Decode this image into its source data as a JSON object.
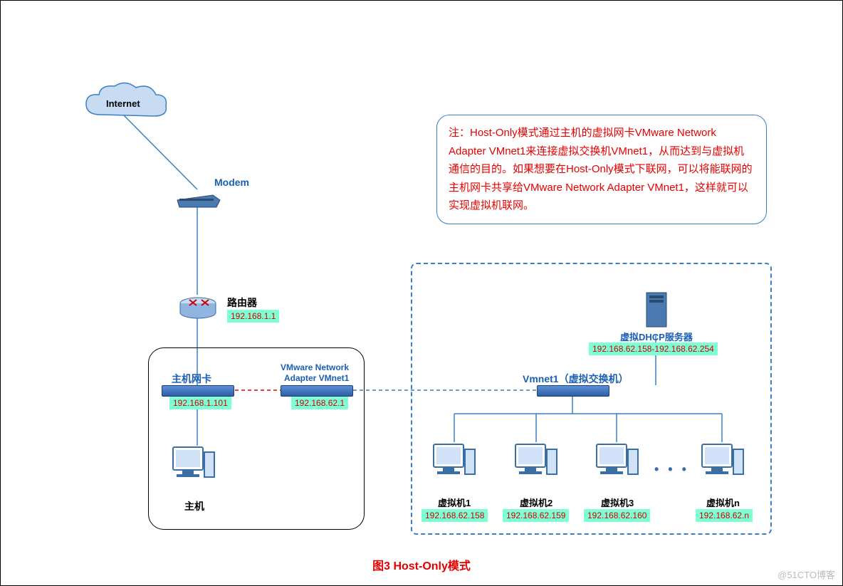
{
  "internet": {
    "label": "Internet"
  },
  "modem": {
    "label": "Modem"
  },
  "router": {
    "label": "路由器",
    "ip": "192.168.1.1"
  },
  "host_box": {
    "nic": {
      "label": "主机网卡",
      "ip": "192.168.1.101"
    },
    "vmnet": {
      "label1": "VMware Network",
      "label2": "Adapter VMnet1",
      "ip": "192.168.62.1"
    },
    "host": {
      "label": "主机"
    }
  },
  "note": {
    "text": "注：Host-Only模式通过主机的虚拟网卡VMware Network Adapter VMnet1来连接虚拟交换机VMnet1，从而达到与虚拟机通信的目的。如果想要在Host-Only模式下联网，可以将能联网的主机网卡共享给VMware Network Adapter VMnet1，这样就可以实现虚拟机联网。"
  },
  "vm_box": {
    "dhcp": {
      "label": "虚拟DHCP服务器",
      "ip": "192.168.62.158-192.168.62.254"
    },
    "switch": {
      "label": "Vmnet1（虚拟交换机）"
    },
    "vms": [
      {
        "label": "虚拟机1",
        "ip": "192.168.62.158"
      },
      {
        "label": "虚拟机2",
        "ip": "192.168.62.159"
      },
      {
        "label": "虚拟机3",
        "ip": "192.168.62.160"
      },
      {
        "label": "虚拟机n",
        "ip": "192.168.62.n"
      }
    ],
    "ellipsis": "• • •"
  },
  "caption": "图3  Host-Only模式",
  "watermark": "@51CTO博客"
}
